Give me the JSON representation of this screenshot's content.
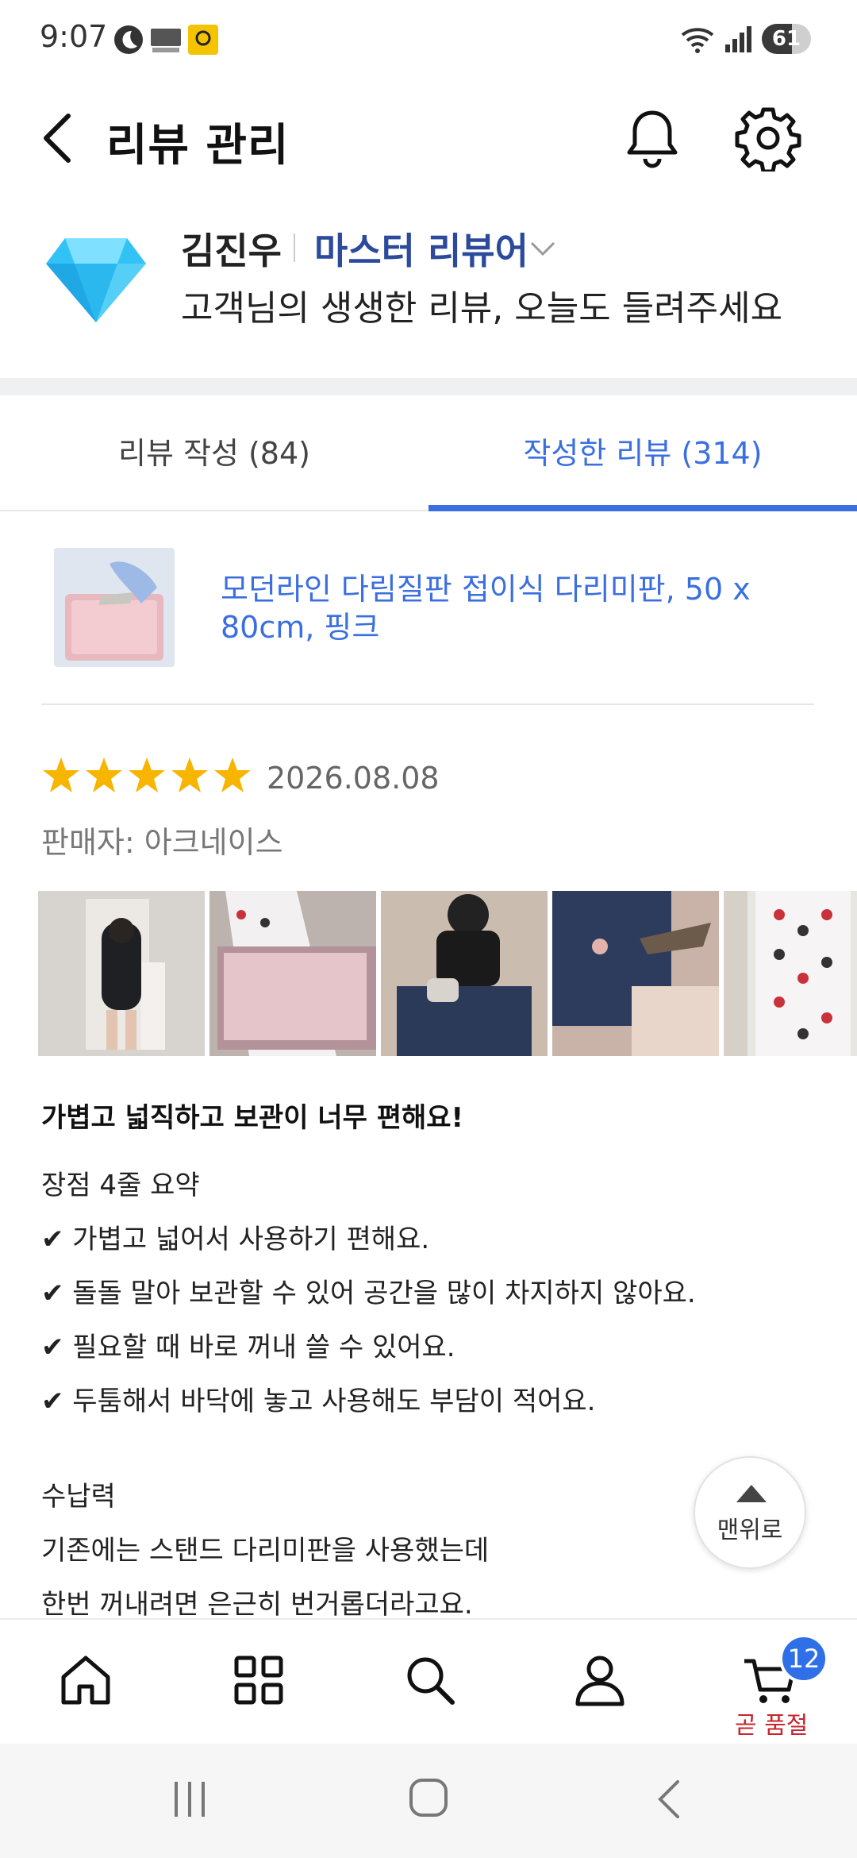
{
  "status_bar": {
    "time": "9:07",
    "battery": "61",
    "battery_pct": 0.61
  },
  "header": {
    "title": "리뷰 관리"
  },
  "profile": {
    "name": "김진우",
    "grade": "마스터 리뷰어",
    "tagline": "고객님의 생생한 리뷰, 오늘도 들려주세요"
  },
  "tabs": [
    {
      "label": "리뷰 작성 (84)",
      "active": false
    },
    {
      "label": "작성한 리뷰 (314)",
      "active": true
    }
  ],
  "product": {
    "title": "모던라인 다림질판 접이식 다리미판, 50 x 80cm, 핑크"
  },
  "review": {
    "stars": 5,
    "date": "2026.08.08",
    "seller": "판매자: 아크네이스",
    "photo_count": 5,
    "title": "가볍고 넓직하고 보관이 너무 편해요!",
    "lines": [
      "장점 4줄 요약",
      "✔ 가볍고 넓어서 사용하기 편해요.",
      "✔ 돌돌 말아 보관할 수 있어 공간을 많이 차지하지 않아요.",
      "✔ 필요할 때 바로 꺼내 쓸 수 있어요.",
      "✔ 두툼해서 바닥에 놓고 사용해도 부담이 적어요."
    ],
    "section_title": "수납력",
    "section_lines": [
      "기존에는 스탠드 다리미판을 사용했는데",
      "한번 꺼내려면 은근히 번거롭더라고요."
    ]
  },
  "scroll_top": {
    "label": "맨위로"
  },
  "bottom_nav": {
    "items": [
      "home-icon",
      "grid-icon",
      "search-icon",
      "person-icon",
      "cart-icon"
    ],
    "cart_badge": "12",
    "cart_label": "곧 품절"
  },
  "colors": {
    "accent": "#3b6fe0",
    "grade": "#2b4a9b",
    "star": "#f7b500",
    "soldout": "#c8252d"
  }
}
